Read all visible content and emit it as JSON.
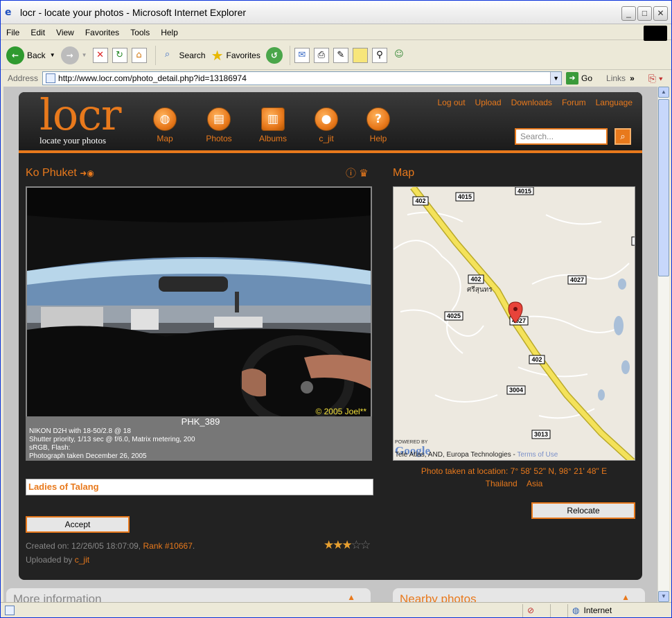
{
  "window": {
    "title": "locr - locate your photos - Microsoft Internet Explorer"
  },
  "menu": [
    "File",
    "Edit",
    "View",
    "Favorites",
    "Tools",
    "Help"
  ],
  "toolbar": {
    "back": "Back",
    "search": "Search",
    "favorites": "Favorites"
  },
  "address": {
    "label": "Address",
    "url": "http://www.locr.com/photo_detail.php?id=13186974",
    "go": "Go",
    "links": "Links"
  },
  "site": {
    "logo": "locr",
    "tagline": "locate your photos",
    "nav": [
      {
        "label": "Map",
        "icon": "globe-icon"
      },
      {
        "label": "Photos",
        "icon": "photos-icon"
      },
      {
        "label": "Albums",
        "icon": "albums-icon"
      },
      {
        "label": "c_jit",
        "icon": "user-icon"
      },
      {
        "label": "Help",
        "icon": "help-icon"
      }
    ],
    "toplinks": [
      "Log out",
      "Upload",
      "Downloads",
      "Forum",
      "Language"
    ],
    "search_placeholder": "Search..."
  },
  "photo": {
    "location_title": "Ko Phuket",
    "copyright": "© 2005 Joel**",
    "filename": "PHK_389",
    "exif": [
      "NIKON D2H with 18-50/2.8 @ 18",
      "Shutter priority, 1/13 sec @ f/6.0, Matrix metering, 200",
      "sRGB, Flash:",
      "Photograph taken December 26, 2005"
    ],
    "title_value": "Ladies of Talang",
    "accept": "Accept",
    "created_label": "Created on: 12/26/05 18:07:09,",
    "rank": "Rank #10667",
    "uploaded_label": "Uploaded by",
    "uploader": "c_jit",
    "rating": 2.5,
    "rating_max": 5
  },
  "map": {
    "title": "Map",
    "road_labels": [
      "4015",
      "402",
      "4015",
      "402",
      "4027",
      "4025",
      "4027",
      "402",
      "3004",
      "3013"
    ],
    "place": "ศรีสุนทร",
    "powered": "POWERED BY",
    "google": "Google",
    "attribution": "Tele Atlas, AND, Europa Technologies -",
    "terms": "Terms of Use",
    "location_line": "Photo taken at location: 7° 58' 52\" N, 98° 21' 48\" E",
    "country": "Thailand",
    "continent": "Asia",
    "relocate": "Relocate"
  },
  "panels": {
    "more": "More information",
    "nearby": "Nearby photos"
  },
  "status": {
    "zone": "Internet"
  }
}
